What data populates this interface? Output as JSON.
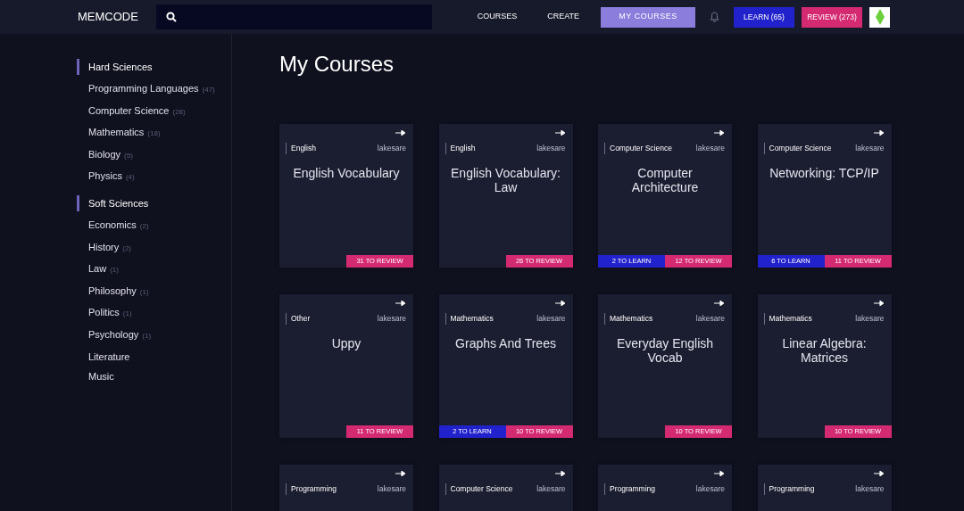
{
  "navbar": {
    "brand": "MEMCODE",
    "links": [
      {
        "label": "COURSES",
        "selected": false
      },
      {
        "label": "CREATE",
        "selected": false
      },
      {
        "label": "MY COURSES",
        "selected": true
      }
    ],
    "learn_button": "LEARN (65)",
    "review_button": "REVIEW (273)"
  },
  "sidebar": {
    "groups": [
      {
        "heading": "Hard Sciences",
        "items": [
          {
            "label": "Programming Languages",
            "count": "(47)"
          },
          {
            "label": "Computer Science",
            "count": "(28)"
          },
          {
            "label": "Mathematics",
            "count": "(18)"
          },
          {
            "label": "Biology",
            "count": "(5)"
          },
          {
            "label": "Physics",
            "count": "(4)"
          }
        ]
      },
      {
        "heading": "Soft Sciences",
        "items": [
          {
            "label": "Economics",
            "count": "(2)"
          },
          {
            "label": "History",
            "count": "(2)"
          },
          {
            "label": "Law",
            "count": "(1)"
          },
          {
            "label": "Philosophy",
            "count": "(1)"
          },
          {
            "label": "Politics",
            "count": "(1)"
          },
          {
            "label": "Psychology",
            "count": "(1)"
          },
          {
            "label": "Literature"
          },
          {
            "label": "Music"
          }
        ]
      }
    ]
  },
  "page_title": "My Courses",
  "courses": [
    {
      "category": "English",
      "author": "lakesare",
      "title": "English Vocabulary",
      "review": "31 TO REVIEW"
    },
    {
      "category": "English",
      "author": "lakesare",
      "title": "English Vocabulary: Law",
      "review": "26 TO REVIEW"
    },
    {
      "category": "Computer Science",
      "author": "lakesare",
      "title": "Computer Architecture",
      "learn": "2 TO LEARN",
      "review": "12 TO REVIEW"
    },
    {
      "category": "Computer Science",
      "author": "lakesare",
      "title": "Networking: TCP/IP",
      "learn": "6 TO LEARN",
      "review": "11 TO REVIEW"
    },
    {
      "category": "Other",
      "author": "lakesare",
      "title": "Uppy",
      "review": "11 TO REVIEW"
    },
    {
      "category": "Mathematics",
      "author": "lakesare",
      "title": "Graphs And Trees",
      "learn": "2 TO LEARN",
      "review": "10 TO REVIEW"
    },
    {
      "category": "Mathematics",
      "author": "lakesare",
      "title": "Everyday English Vocab",
      "review": "10 TO REVIEW"
    },
    {
      "category": "Mathematics",
      "author": "lakesare",
      "title": "Linear Algebra: Matrices",
      "review": "10 TO REVIEW"
    },
    {
      "category": "Programming",
      "author": "lakesare"
    },
    {
      "category": "Computer Science",
      "author": "lakesare"
    },
    {
      "category": "Programming",
      "author": "lakesare"
    },
    {
      "category": "Programming",
      "author": "lakesare"
    }
  ]
}
